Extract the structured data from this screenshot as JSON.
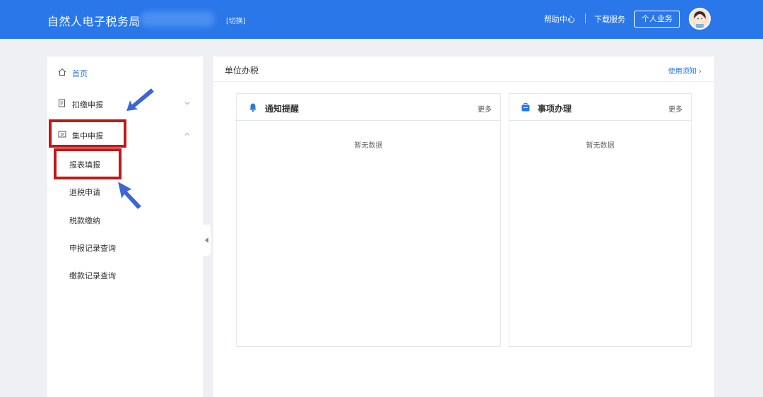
{
  "header": {
    "brand": "自然人电子税务局",
    "switch_label": "[切换]",
    "help_label": "帮助中心",
    "download_label": "下载服务",
    "personal_label": "个人业务"
  },
  "sidebar": {
    "home_label": "首页",
    "withhold_label": "扣缴申报",
    "central_label": "集中申报",
    "sub_items": [
      "报表填报",
      "退税申请",
      "税款缴纳",
      "申报记录查询",
      "缴款记录查询"
    ]
  },
  "main": {
    "title": "单位办税",
    "usage_label": "使用须知 ›",
    "notice_card": {
      "title": "通知提醒",
      "more": "更多",
      "empty": "暂无数据"
    },
    "matter_card": {
      "title": "事项办理",
      "more": "更多",
      "empty": "暂无数据"
    }
  },
  "colors": {
    "primary": "#2a77ea",
    "highlight": "#c01818",
    "arrow": "#3a66d6"
  }
}
